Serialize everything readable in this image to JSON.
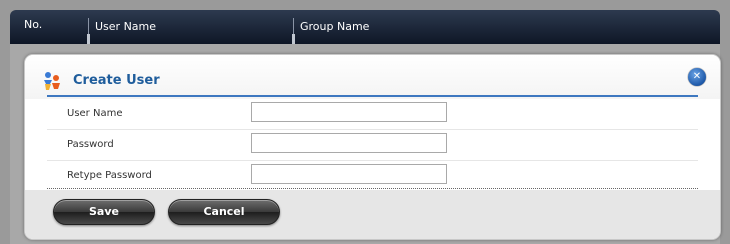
{
  "table": {
    "columns": [
      "No.",
      "User Name",
      "Group Name"
    ]
  },
  "dialog": {
    "title": "Create User",
    "close_icon": "close-icon",
    "title_icon": "users-icon",
    "fields": [
      {
        "label": "User Name",
        "value": ""
      },
      {
        "label": "Password",
        "value": ""
      },
      {
        "label": "Retype Password",
        "value": ""
      }
    ],
    "buttons": {
      "save_label": "Save",
      "cancel_label": "Cancel"
    }
  },
  "colors": {
    "header_bg": "#0e1626",
    "title_blue": "#1f5d9c",
    "rule_blue": "#3e78c0",
    "button_dark": "#2e2e2e"
  }
}
